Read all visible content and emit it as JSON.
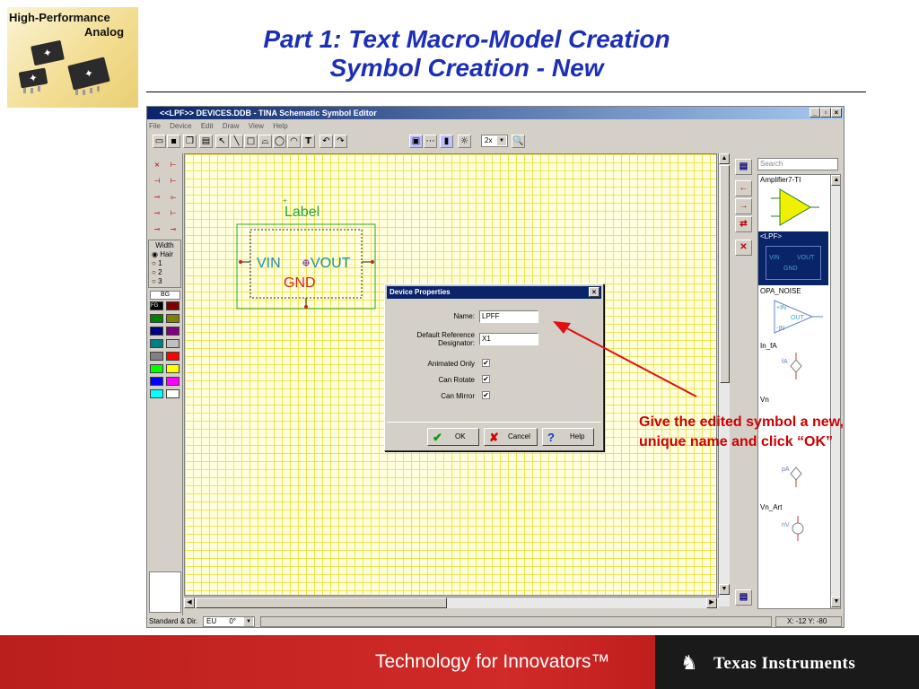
{
  "logo": {
    "line1": "High-Performance",
    "line2": "Analog"
  },
  "slide": {
    "title_line1": "Part 1: Text Macro-Model Creation",
    "title_line2": "Symbol Creation - New"
  },
  "window": {
    "title": "<<LPF>> DEVICES.DDB - TINA Schematic Symbol Editor",
    "menu": [
      "File",
      "Device",
      "Edit",
      "Draw",
      "View",
      "Help"
    ],
    "zoom": "2x",
    "width_label": "Width",
    "width_options": [
      "Hair",
      "1",
      "2",
      "3"
    ],
    "bg_label": "BG",
    "fg_label": "FG"
  },
  "symbol": {
    "label": "Label",
    "left_pin": "VIN",
    "right_pin": "VOUT",
    "bottom_pin": "GND"
  },
  "library": {
    "search_placeholder": "Search",
    "items": [
      {
        "name": "Amplifier7-TI"
      },
      {
        "name": "<LPF>",
        "pins": [
          "VIN",
          "VOUT",
          "GND"
        ]
      },
      {
        "name": "OPA_NOISE",
        "pins": [
          "+IN",
          "OUT",
          "-IN"
        ]
      },
      {
        "name": "In_fA",
        "value": "fA"
      },
      {
        "name": "Vn"
      },
      {
        "name": "pA"
      },
      {
        "name": "Vn_Art",
        "value": "nV"
      }
    ]
  },
  "status": {
    "standard_label": "Standard & Dir.",
    "standard_value": "EU",
    "angle": "0°",
    "coords": "X: -12 Y: -80"
  },
  "dialog": {
    "title": "Device Properties",
    "name_label": "Name:",
    "name_value": "LPFF",
    "ref_label_1": "Default Reference",
    "ref_label_2": "Designator:",
    "ref_value": "X1",
    "animated_label": "Animated Only",
    "rotate_label": "Can Rotate",
    "mirror_label": "Can Mirror",
    "ok_label": "OK",
    "cancel_label": "Cancel",
    "help_label": "Help"
  },
  "callout": {
    "line1": "Give the edited symbol a new,",
    "line2": "unique name and click “OK”"
  },
  "footer": {
    "tagline": "Technology for Innovators™",
    "brand": "Texas Instruments"
  },
  "colors": {
    "title": "#1c2fb6",
    "callout": "#cc0000",
    "footer_red": "#c8221f",
    "dialog_title": "#0a246a"
  }
}
